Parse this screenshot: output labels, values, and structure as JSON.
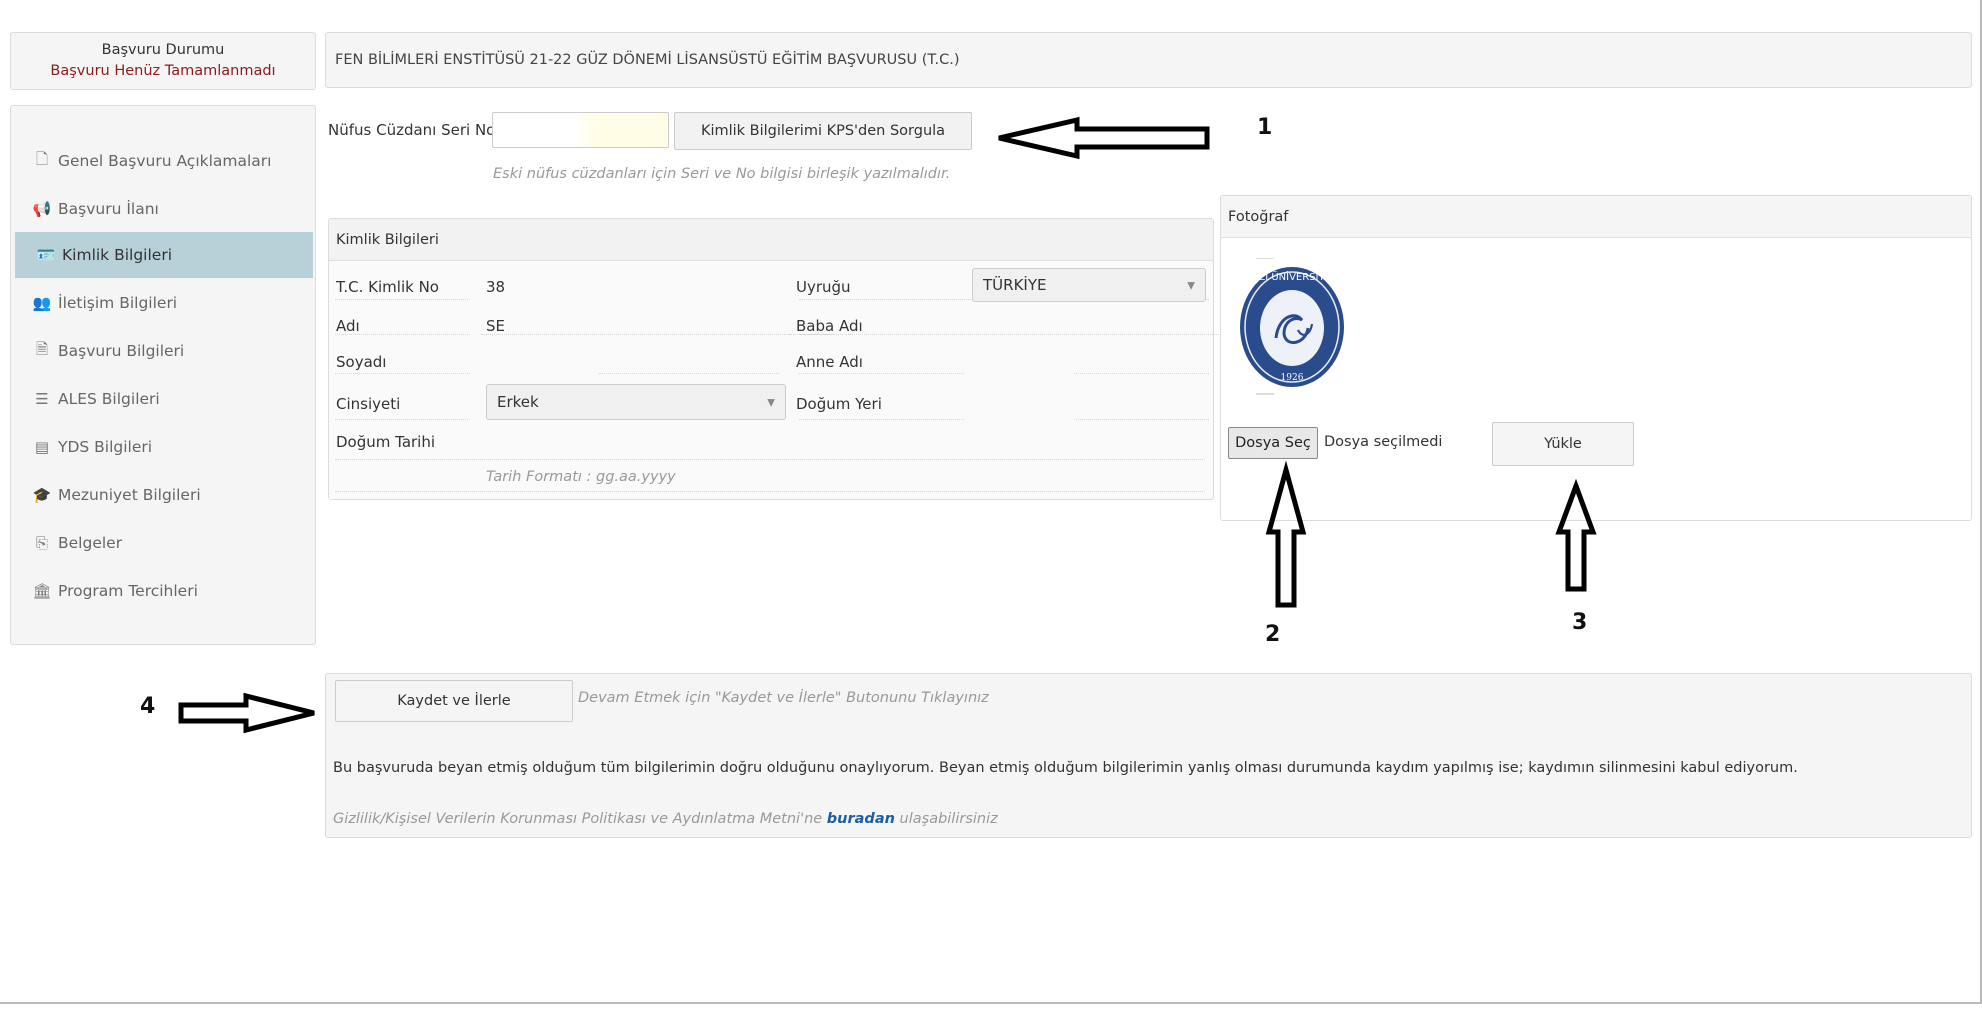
{
  "status": {
    "title": "Başvuru Durumu",
    "state": "Başvuru Henüz Tamamlanmadı",
    "state_color": "#8b1a1a"
  },
  "sidebar": {
    "items": [
      {
        "label": "Genel Başvuru Açıklamaları",
        "icon": "document-icon",
        "glyph": "🗋"
      },
      {
        "label": "Başvuru İlanı",
        "icon": "megaphone-icon",
        "glyph": "📢"
      },
      {
        "label": "Kimlik Bilgileri",
        "icon": "id-card-icon",
        "glyph": "🪪",
        "active": true
      },
      {
        "label": "İletişim Bilgileri",
        "icon": "contact-icon",
        "glyph": "👥"
      },
      {
        "label": "Başvuru Bilgileri",
        "icon": "file-icon",
        "glyph": "🗎"
      },
      {
        "label": "ALES Bilgileri",
        "icon": "list-icon",
        "glyph": "☰"
      },
      {
        "label": "YDS Bilgileri",
        "icon": "list-alt-icon",
        "glyph": "▤"
      },
      {
        "label": "Mezuniyet Bilgileri",
        "icon": "graduation-cap-icon",
        "glyph": "🎓"
      },
      {
        "label": "Belgeler",
        "icon": "copy-icon",
        "glyph": "⎘"
      },
      {
        "label": "Program Tercihleri",
        "icon": "institution-icon",
        "glyph": "🏛"
      }
    ],
    "active_color": "#b8d1d9"
  },
  "header": {
    "title": "FEN BİLİMLERİ ENSTİTÜSÜ 21-22 GÜZ DÖNEMİ LİSANSÜSTÜ EĞİTİM BAŞVURUSU (T.C.)"
  },
  "serial": {
    "label": "Nüfus Cüzdanı Seri No",
    "value": "",
    "query_button": "Kimlik Bilgilerimi KPS'den Sorgula",
    "hint": "Eski nüfus cüzdanları için Seri ve No bilgisi birleşik yazılmalıdır."
  },
  "identity": {
    "title": "Kimlik Bilgileri",
    "tc_label": "T.C. Kimlik No",
    "tc_value": "38",
    "name_label": "Adı",
    "name_value": "SE",
    "surname_label": "Soyadı",
    "surname_value": "",
    "gender_label": "Cinsiyeti",
    "gender_value": "Erkek",
    "birthdate_label": "Doğum Tarihi",
    "birthdate_value": "",
    "date_hint": "Tarih Formatı : gg.aa.yyyy",
    "nationality_label": "Uyruğu",
    "nationality_value": "TÜRKİYE",
    "father_label": "Baba Adı",
    "father_value": "",
    "mother_label": "Anne Adı",
    "mother_value": "",
    "birthplace_label": "Doğum Yeri",
    "birthplace_value": ""
  },
  "photo": {
    "title": "Fotoğraf",
    "seal_text": "GAZİ ÜNİVERSİTESİ",
    "seal_year": "1926",
    "seal_color": "#2b4c8c",
    "choose_button": "Dosya Seç",
    "no_file": "Dosya seçilmedi",
    "upload_button": "Yükle"
  },
  "bottom": {
    "save_button": "Kaydet ve İlerle",
    "save_hint": "Devam Etmek için \"Kaydet ve İlerle\" Butonunu Tıklayınız",
    "declaration": "Bu başvuruda beyan etmiş olduğum tüm bilgilerimin doğru olduğunu onaylıyorum. Beyan etmiş olduğum bilgilerimin yanlış olması durumunda kaydım yapılmış ise; kaydımın silinmesini kabul ediyorum.",
    "privacy_pre": "Gizlilik/Kişisel Verilerin Korunması Politikası ve Aydınlatma Metni'ne",
    "privacy_link": "buradan",
    "privacy_post": "ulaşabilirsiniz"
  },
  "annotations": {
    "n1": "1",
    "n2": "2",
    "n3": "3",
    "n4": "4"
  }
}
